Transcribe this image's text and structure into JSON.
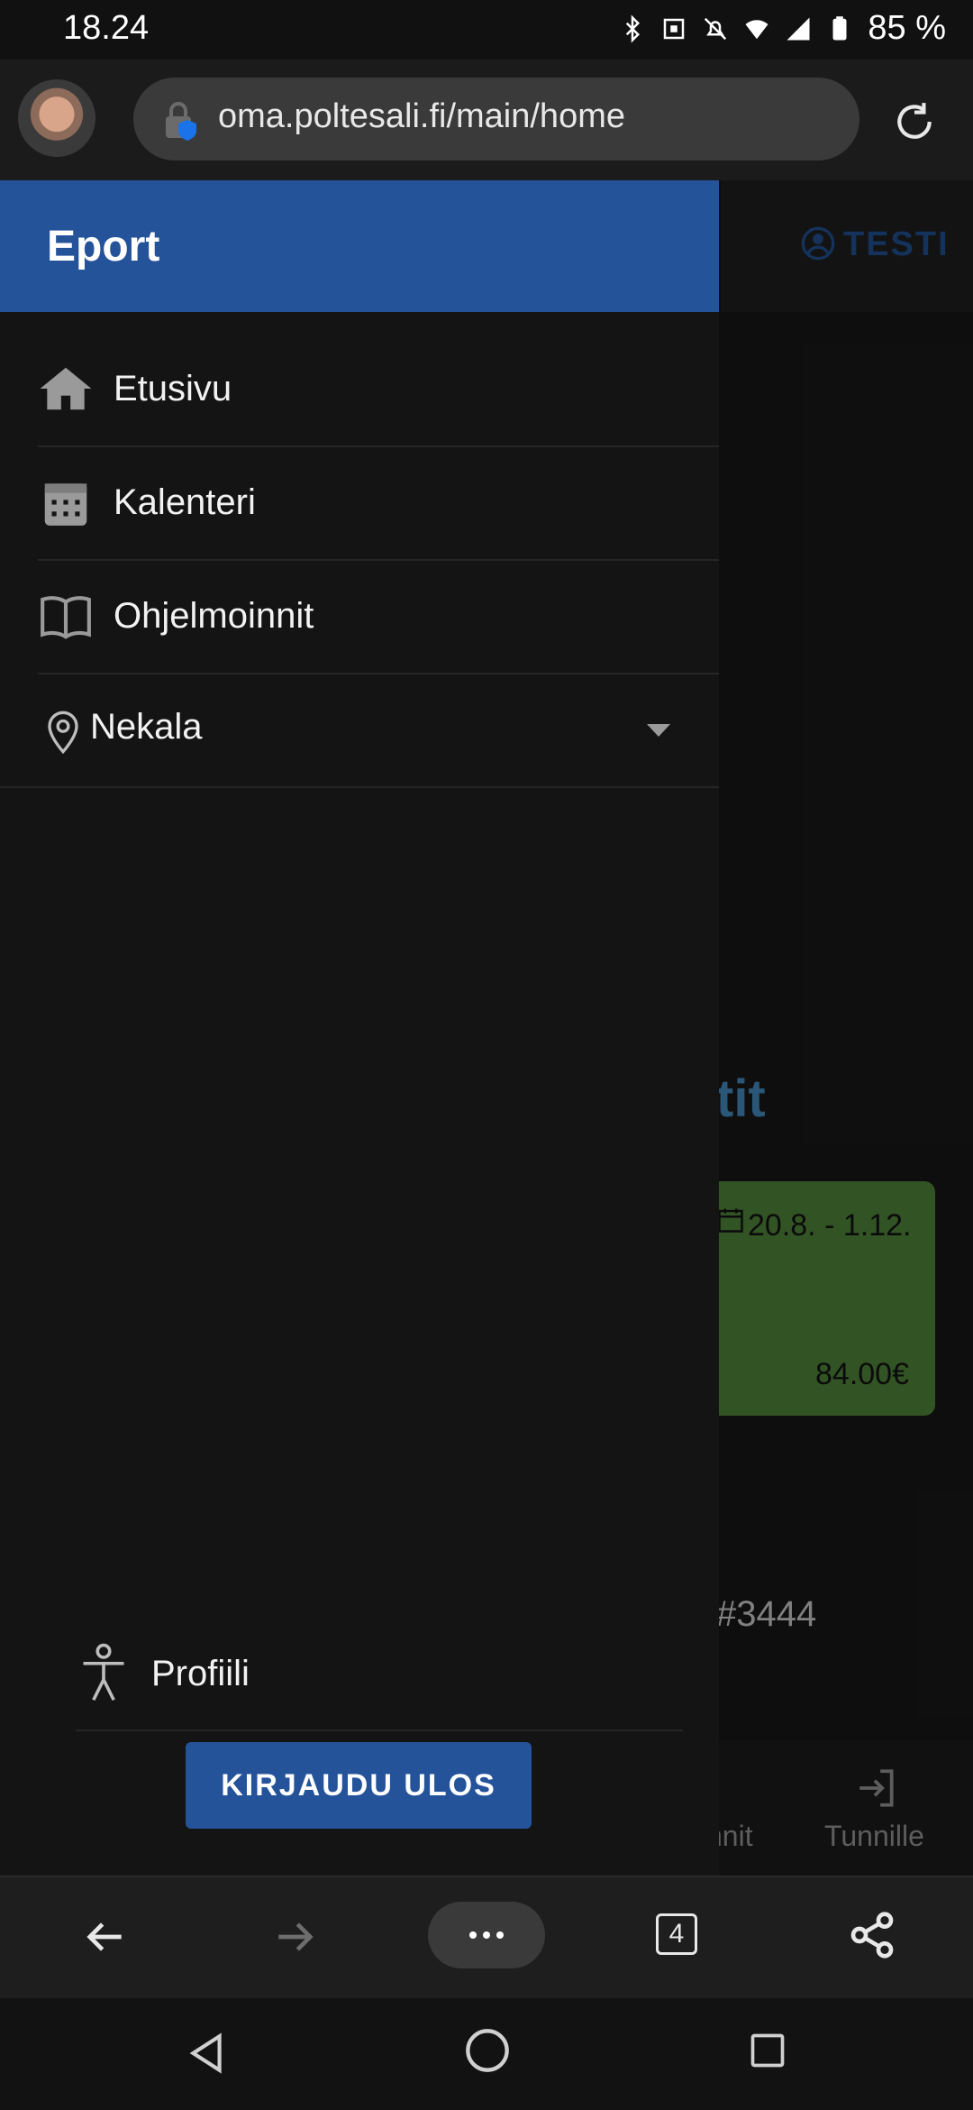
{
  "status_bar": {
    "time": "18.24",
    "battery": "85 %"
  },
  "browser": {
    "url": "oma.poltesali.fi/main/home",
    "tab_count": "4"
  },
  "background_page": {
    "user_label": "TESTI",
    "heading_fragment": "tit",
    "card": {
      "date": "20.8. - 1.12.",
      "price": "84.00€",
      "color": "#4a7c35"
    },
    "id_fragment": "#3444",
    "nav": {
      "item1": "nnit",
      "item2": "Tunnille"
    }
  },
  "drawer": {
    "title": "Eport",
    "accent": "#25539a",
    "items": [
      {
        "label": "Etusivu",
        "icon": "home-icon"
      },
      {
        "label": "Kalenteri",
        "icon": "calendar-icon"
      },
      {
        "label": "Ohjelmoinnit",
        "icon": "book-icon"
      }
    ],
    "location": {
      "label": "Nekala",
      "icon": "location-pin-icon"
    },
    "profile_label": "Profiili",
    "logout_label": "KIRJAUDU ULOS"
  }
}
